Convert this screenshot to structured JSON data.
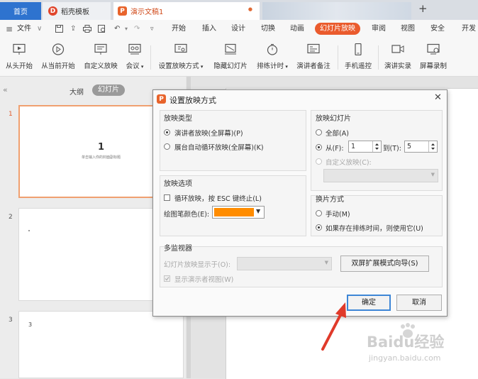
{
  "tabs": {
    "home": "首页",
    "template": "稻壳模板",
    "template_logo": "D",
    "document": "演示文稿1",
    "document_logo": "P",
    "modified_dot": "●",
    "new_tab": "+"
  },
  "menu": {
    "items": [
      "文件",
      "开始",
      "插入",
      "设计",
      "切换",
      "动画",
      "幻灯片放映",
      "审阅",
      "视图",
      "安全",
      "开发"
    ],
    "active": "幻灯片放映"
  },
  "ribbon": {
    "buttons": [
      {
        "label": "从头开始",
        "icon": "play-from-start-icon"
      },
      {
        "label": "从当前开始",
        "icon": "play-circle-icon"
      },
      {
        "label": "自定义放映",
        "icon": "custom-show-icon"
      },
      {
        "label": "会议",
        "icon": "meeting-icon"
      },
      {
        "label": "设置放映方式",
        "icon": "setup-show-icon"
      },
      {
        "label": "隐藏幻灯片",
        "icon": "hide-slide-icon"
      },
      {
        "label": "排练计时",
        "icon": "stopwatch-icon"
      },
      {
        "label": "演讲者备注",
        "icon": "speaker-notes-icon"
      },
      {
        "label": "手机遥控",
        "icon": "phone-remote-icon"
      },
      {
        "label": "演讲实录",
        "icon": "record-camera-icon"
      },
      {
        "label": "屏幕录制",
        "icon": "screen-record-icon"
      }
    ]
  },
  "left_panel": {
    "collapse": "«",
    "view_outline": "大纲",
    "view_slides": "幻灯片",
    "slides": [
      {
        "number": "1",
        "title": "1",
        "subtitle": "单击输入你的封面副标题",
        "selected": true
      },
      {
        "number": "2",
        "title": "",
        "subtitle": "",
        "selected": false
      },
      {
        "number": "3",
        "title": "3",
        "subtitle": "",
        "selected": false
      }
    ]
  },
  "dialog": {
    "title": "设置放映方式",
    "icon_letter": "P",
    "show_type": {
      "title": "放映类型",
      "options": [
        "演讲者放映(全屏幕)(P)",
        "展台自动循环放映(全屏幕)(K)"
      ],
      "selected": 0
    },
    "show_slides": {
      "title": "放映幻灯片",
      "all": "全部(A)",
      "from": "从(F):",
      "from_value": "1",
      "to": "到(T):",
      "to_value": "5",
      "custom": "自定义放映(C):",
      "selected": "from"
    },
    "show_options": {
      "title": "放映选项",
      "loop": "循环放映，按 ESC 键终止(L)",
      "pen_color": "绘图笔颜色(E):",
      "pen_color_value": "#ff8c00"
    },
    "advance": {
      "title": "换片方式",
      "manual": "手动(M)",
      "timings": "如果存在排练时间，则使用它(U)",
      "selected": "timings"
    },
    "monitors": {
      "title": "多监视器",
      "display_on": "幻灯片放映显示于(O):",
      "presenter_view": "显示演示者视图(W)",
      "dual_screen": "双屏扩展模式向导(S)"
    },
    "ok": "确定",
    "cancel": "取消"
  },
  "watermark": {
    "brand": "Baidu经验",
    "url": "jingyan.baidu.com"
  },
  "colors": {
    "accent": "#ea5b2d",
    "home_tab": "#2e73cf",
    "arrow": "#e03a2a",
    "ok_border": "#3d86d6"
  }
}
